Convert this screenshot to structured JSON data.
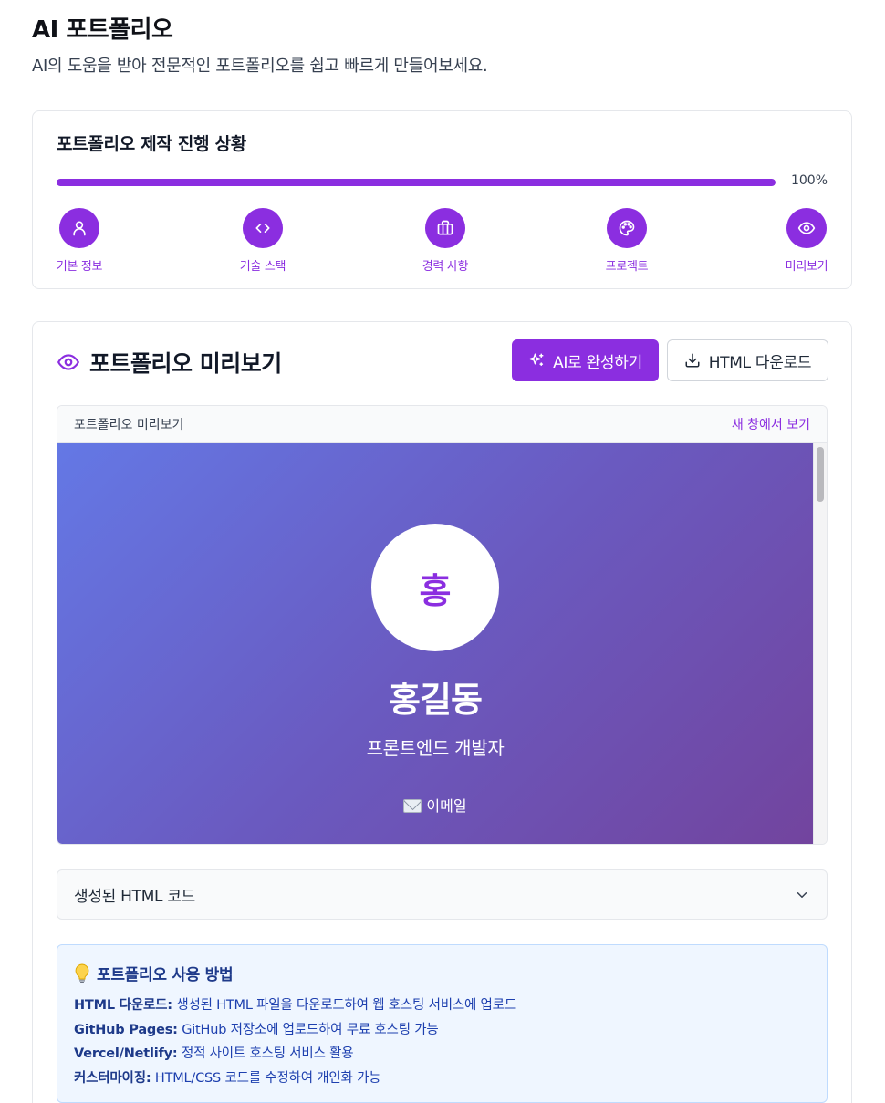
{
  "page": {
    "title": "AI 포트폴리오",
    "subtitle": "AI의 도움을 받아 전문적인 포트폴리오를 쉽고 빠르게 만들어보세요."
  },
  "progress": {
    "title": "포트폴리오 제작 진행 상황",
    "percent_label": "100%",
    "value": 1.0,
    "accent_color": "#8b2ee0",
    "steps": [
      {
        "label": "기본 정보",
        "icon": "user-icon"
      },
      {
        "label": "기술 스택",
        "icon": "code-icon"
      },
      {
        "label": "경력 사항",
        "icon": "briefcase-icon"
      },
      {
        "label": "프로젝트",
        "icon": "palette-icon"
      },
      {
        "label": "미리보기",
        "icon": "eye-icon"
      }
    ]
  },
  "preview": {
    "heading": "포트폴리오 미리보기",
    "ai_button_label": "AI로 완성하기",
    "download_button_label": "HTML 다운로드",
    "frame_title": "포트폴리오 미리보기",
    "open_new_window_label": "새 창에서 보기",
    "hero": {
      "avatar_initial": "홍",
      "name": "홍길동",
      "role": "프론트엔드 개발자",
      "email_label": "이메일"
    },
    "code_panel_label": "생성된 HTML 코드"
  },
  "tips": {
    "title": "포트폴리오 사용 방법",
    "items": [
      {
        "term": "HTML 다운로드:",
        "desc": "생성된 HTML 파일을 다운로드하여 웹 호스팅 서비스에 업로드"
      },
      {
        "term": "GitHub Pages:",
        "desc": "GitHub 저장소에 업로드하여 무료 호스팅 가능"
      },
      {
        "term": "Vercel/Netlify:",
        "desc": "정적 사이트 호스팅 서비스 활용"
      },
      {
        "term": "커스터마이징:",
        "desc": "HTML/CSS 코드를 수정하여 개인화 가능"
      }
    ]
  }
}
